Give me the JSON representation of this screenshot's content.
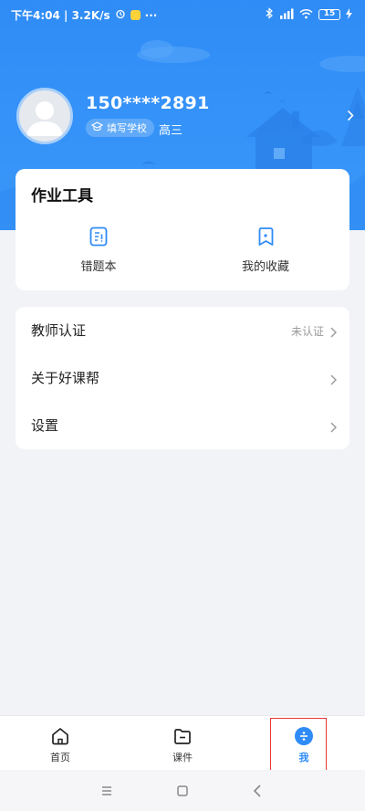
{
  "status_bar": {
    "time_speed": "下午4:04 | 3.2K/s",
    "dots": "···",
    "battery": "15"
  },
  "profile": {
    "phone": "150****2891",
    "school_button": "填写学校",
    "grade": "高三"
  },
  "tools": {
    "title": "作业工具",
    "items": [
      {
        "label": "错题本",
        "icon": "wrongbook-icon"
      },
      {
        "label": "我的收藏",
        "icon": "bookmark-icon"
      }
    ]
  },
  "menu": [
    {
      "label": "教师认证",
      "value": "未认证"
    },
    {
      "label": "关于好课帮",
      "value": ""
    },
    {
      "label": "设置",
      "value": ""
    }
  ],
  "tab_bar": [
    {
      "label": "首页",
      "icon": "home-icon"
    },
    {
      "label": "课件",
      "icon": "folder-icon"
    },
    {
      "label": "我",
      "icon": "me-icon",
      "active": true
    }
  ],
  "colors": {
    "accent": "#2f8cf6",
    "highlight_box": "#e53935",
    "background": "#f2f3f7"
  }
}
